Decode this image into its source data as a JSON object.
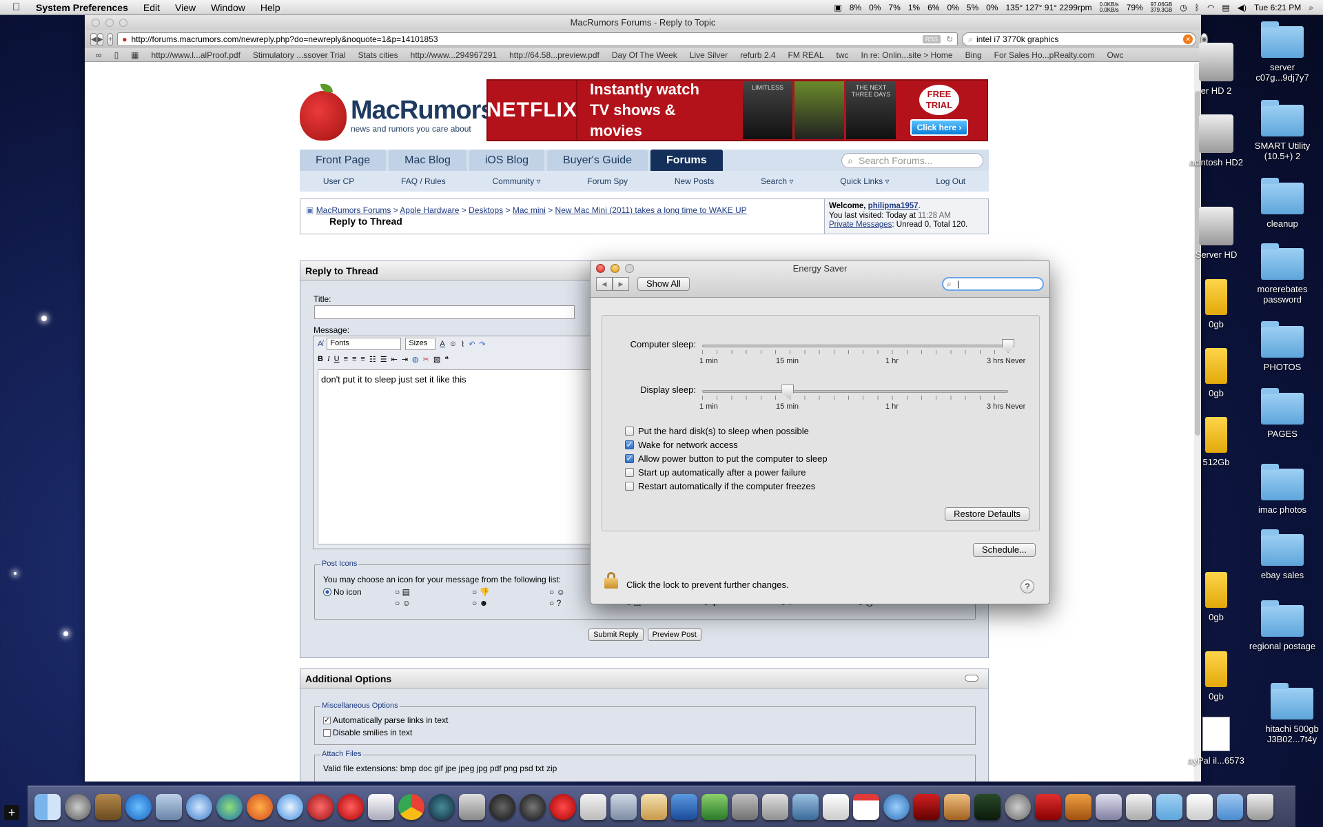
{
  "menubar": {
    "app": "System Preferences",
    "items": [
      "Edit",
      "View",
      "Window",
      "Help"
    ],
    "status": {
      "cpu": [
        "8%",
        "0%",
        "7%",
        "1%",
        "6%",
        "0%",
        "5%",
        "0%"
      ],
      "temps": "135° 127° 91° 2299rpm",
      "net_up": "0.0KB/s",
      "net_down": "0.0KB/s",
      "battery": "79%",
      "disk_a": "97.06GB",
      "disk_b": "379.3GB",
      "clock": "Tue 6:21 PM"
    }
  },
  "browser": {
    "title": "MacRumors Forums - Reply to Topic",
    "url": "http://forums.macrumors.com/newreply.php?do=newreply&noquote=1&p=14101853",
    "rss": "RSS",
    "search": "intel i7 3770k graphics",
    "bookmarks": [
      "http://www.l...alProof.pdf",
      "Stimulatory ...ssover Trial",
      "Stats cities",
      "http://www...294967291",
      "http://64.58...preview.pdf",
      "Day Of The Week",
      "Live Silver",
      "refurb 2.4",
      "FM REAL",
      "twc",
      "In re: Onlin...site > Home",
      "Bing",
      "For Sales Ho...pRealty.com",
      "Owc"
    ]
  },
  "site": {
    "logo_name": "MacRumors",
    "logo_tag": "news and rumors you care about",
    "ad": {
      "brand": "NETFLIX",
      "line1": "Instantly watch",
      "line2": "TV shows & movies",
      "poster1": "LIMITLESS",
      "poster2": "",
      "poster3": "THE NEXT THREE DAYS",
      "badge": "FREE TRIAL",
      "cta": "Click here ›"
    },
    "tabs": [
      "Front Page",
      "Mac Blog",
      "iOS Blog",
      "Buyer's Guide",
      "Forums"
    ],
    "search_placeholder": "Search Forums...",
    "subnav": [
      "User CP",
      "FAQ / Rules",
      "Community ▿",
      "Forum Spy",
      "New Posts",
      "Search ▿",
      "Quick Links ▿",
      "Log Out"
    ],
    "crumbs": [
      "MacRumors Forums",
      "Apple Hardware",
      "Desktops",
      "Mac mini",
      "New Mac Mini (2011) takes a long time to WAKE UP"
    ],
    "crumb_sep": " > ",
    "page_title": "Reply to Thread",
    "welcome": {
      "label": "Welcome, ",
      "user": "philipma1957",
      "visited_label": "You last visited: Today at ",
      "visited_time": "11:28 AM",
      "pm_label": "Private Messages",
      "pm_text": ": Unread 0, Total 120."
    },
    "reply": {
      "header": "Reply to Thread",
      "title_label": "Title:",
      "message_label": "Message:",
      "fonts": "Fonts",
      "sizes": "Sizes",
      "message": "don't put it to sleep just set it like this",
      "icons_legend": "Post Icons",
      "icons_text": "You may choose an icon for your message from the following list:",
      "no_icon": "No icon",
      "submit": "Submit Reply",
      "preview": "Preview Post"
    },
    "additional": {
      "header": "Additional Options",
      "misc_legend": "Miscellaneous Options",
      "opt1": "Automatically parse links in text",
      "opt2": "Disable smilies in text",
      "attach_legend": "Attach Files",
      "attach_text": "Valid file extensions: bmp doc gif jpe jpeg jpg pdf png psd txt zip"
    }
  },
  "energy": {
    "title": "Energy Saver",
    "show_all": "Show All",
    "search_value": "",
    "computer_sleep": {
      "label": "Computer sleep:",
      "value": "Never",
      "position": 1.0
    },
    "display_sleep": {
      "label": "Display sleep:",
      "value": "15 min",
      "position": 0.28
    },
    "ticks": [
      "1 min",
      "15 min",
      "1 hr",
      "3 hrs",
      "Never"
    ],
    "options": [
      {
        "label": "Put the hard disk(s) to sleep when possible",
        "checked": false
      },
      {
        "label": "Wake for network access",
        "checked": true
      },
      {
        "label": "Allow power button to put the computer to sleep",
        "checked": true
      },
      {
        "label": "Start up automatically after a power failure",
        "checked": false
      },
      {
        "label": "Restart automatically if the computer freezes",
        "checked": false
      }
    ],
    "restore": "Restore Defaults",
    "schedule": "Schedule...",
    "lock_text": "Click the lock to prevent further changes.",
    "help": "?"
  },
  "desktop": {
    "icons": [
      {
        "name": "server c07g...9dj7y7",
        "kind": "folder"
      },
      {
        "name": "SMART Utility (10.5+) 2",
        "kind": "folder"
      },
      {
        "name": "cleanup",
        "kind": "folder"
      },
      {
        "name": "morerebates password",
        "kind": "folder"
      },
      {
        "name": "PHOTOS",
        "kind": "folder"
      },
      {
        "name": "PAGES",
        "kind": "folder"
      },
      {
        "name": "imac photos",
        "kind": "folder"
      },
      {
        "name": "ebay sales",
        "kind": "folder"
      },
      {
        "name": "regional postage",
        "kind": "folder"
      },
      {
        "name": "hitachi 500gb J3B02...7t4y",
        "kind": "folder"
      }
    ],
    "drives": [
      "er HD 2",
      "acintosh HD2",
      "Server HD",
      "0gb",
      "0gb",
      "512Gb",
      "0gb",
      "0gb",
      "ayPal il...6573"
    ]
  }
}
